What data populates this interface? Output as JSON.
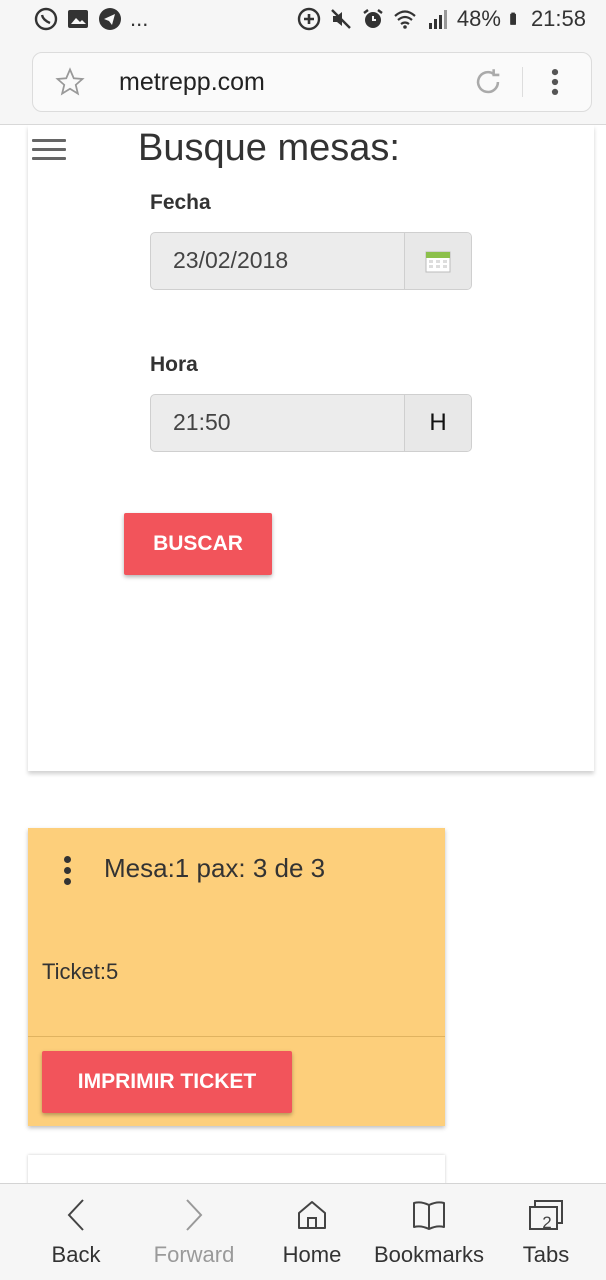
{
  "status_bar": {
    "notification_icons": [
      "whatsapp-icon",
      "gallery-icon",
      "telegram-icon"
    ],
    "more": "...",
    "battery": "48%",
    "time": "21:58"
  },
  "browser": {
    "url": "metrepp.com"
  },
  "search_form": {
    "title": "Busque mesas:",
    "date_label": "Fecha",
    "date_value": "23/02/2018",
    "time_label": "Hora",
    "time_value": "21:50",
    "time_addon": "H",
    "search_button": "BUSCAR"
  },
  "ticket_card": {
    "title": "Mesa:1 pax: 3 de 3",
    "info": "Ticket:5",
    "print_button": "IMPRIMIR TICKET",
    "background": "#fdcf7b"
  },
  "bottom_nav": {
    "back": "Back",
    "forward": "Forward",
    "home": "Home",
    "bookmarks": "Bookmarks",
    "tabs": "Tabs",
    "tabs_count": "2"
  },
  "colors": {
    "accent_button": "#f2545b"
  }
}
